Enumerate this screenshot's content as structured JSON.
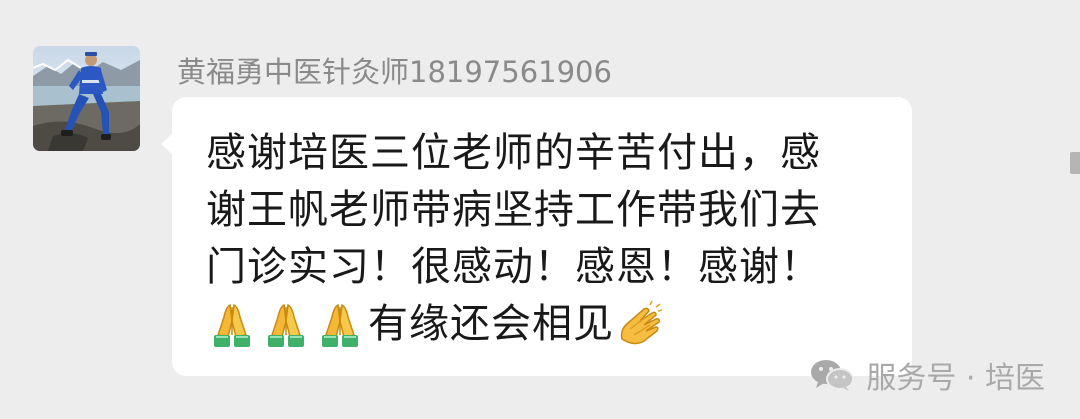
{
  "sender": {
    "name": "黄福勇中医针灸师18197561906"
  },
  "message": {
    "lines": [
      "感谢培医三位老师的辛苦付出，感",
      "谢王帆老师带病坚持工作带我们去",
      "门诊实习！很感动！感恩！感谢！"
    ],
    "last_line_text": "有缘还会相见",
    "emojis": [
      "folded-hands-icon",
      "folded-hands-icon",
      "folded-hands-icon",
      "clapping-hands-icon"
    ]
  },
  "watermark": {
    "text": "服务号 · 培医",
    "icon": "wechat-icon"
  },
  "colors": {
    "background": "#ededed",
    "bubble": "#ffffff",
    "name_text": "#8a8a8a",
    "message_text": "#191919",
    "watermark_text": "#a9a9a9"
  }
}
